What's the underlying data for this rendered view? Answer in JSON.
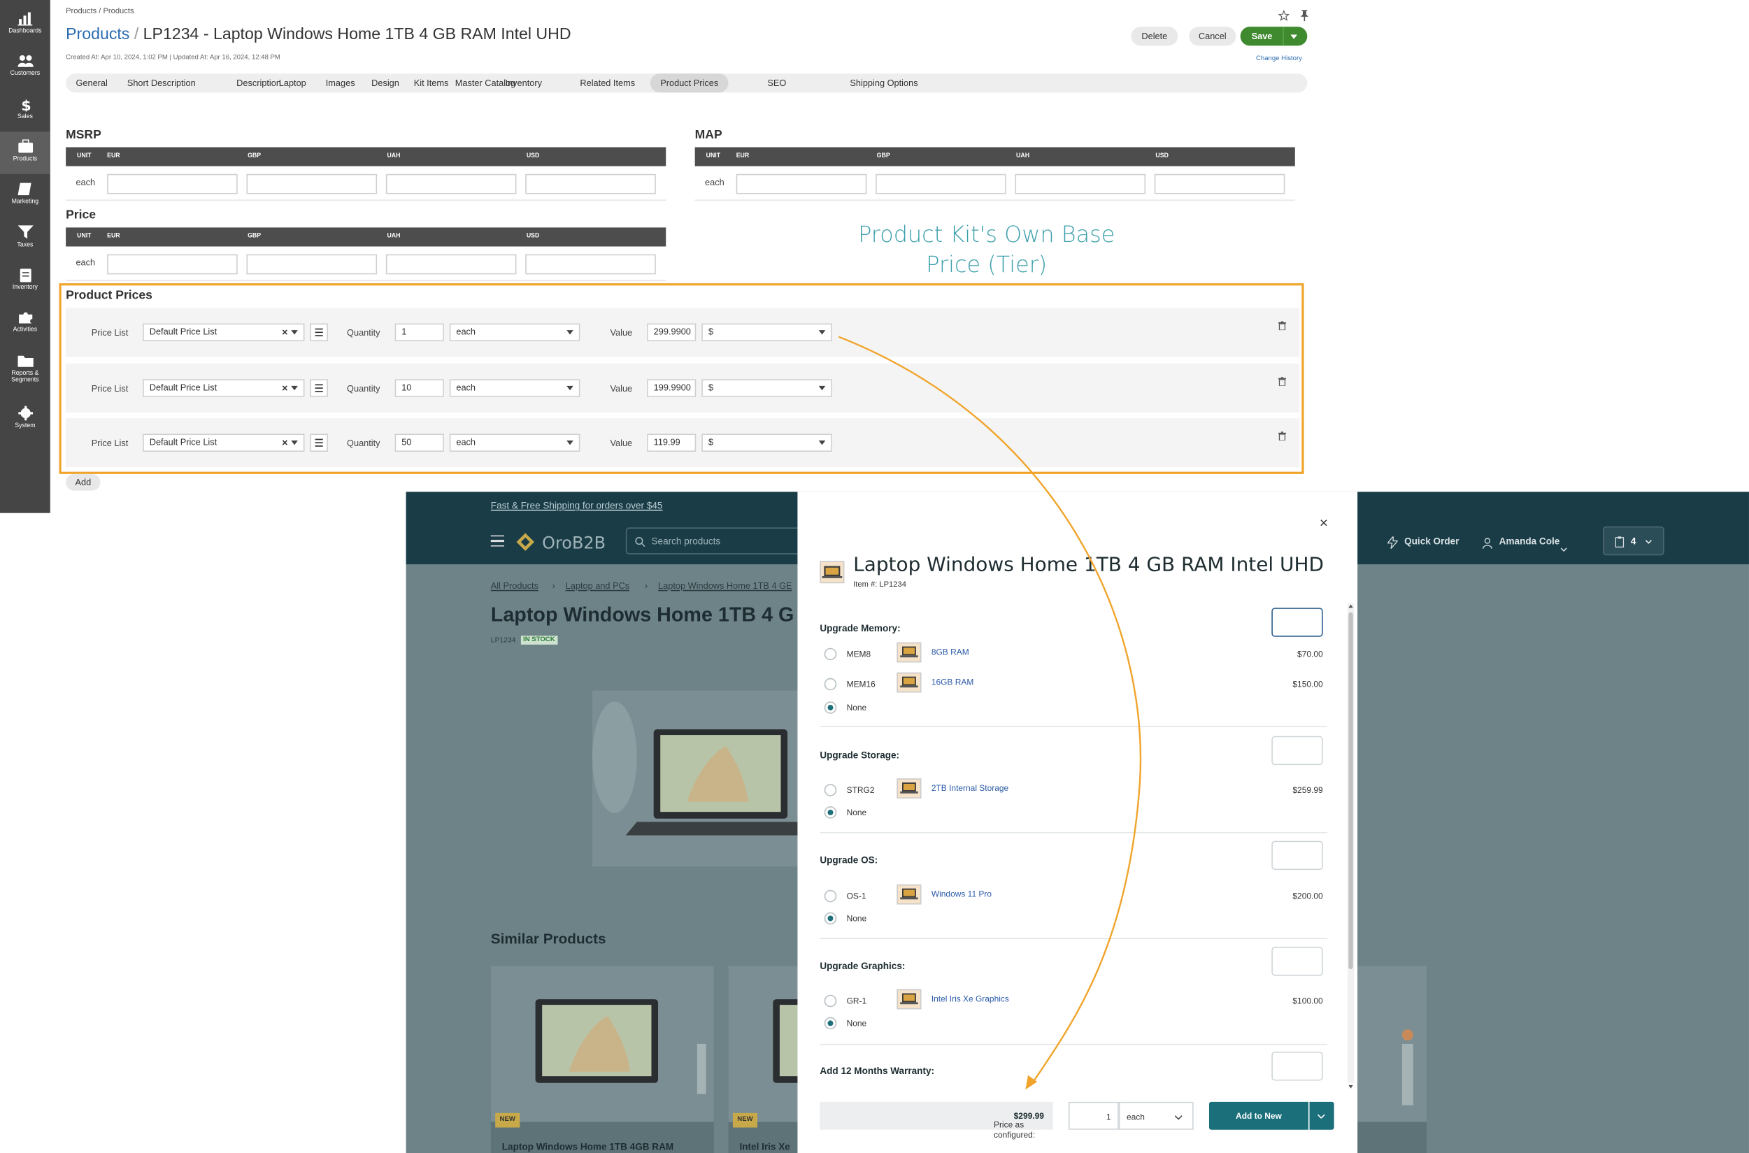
{
  "sidebar": {
    "items": [
      {
        "label": "Dashboards",
        "icon": "bar-chart-icon"
      },
      {
        "label": "Customers",
        "icon": "users-icon"
      },
      {
        "label": "Sales",
        "icon": "dollar-icon"
      },
      {
        "label": "Products",
        "icon": "briefcase-icon",
        "active": true
      },
      {
        "label": "Marketing",
        "icon": "book-icon"
      },
      {
        "label": "Taxes",
        "icon": "filter-icon"
      },
      {
        "label": "Inventory",
        "icon": "clipboard-icon"
      },
      {
        "label": "Activities",
        "icon": "puzzle-icon"
      },
      {
        "label": "Reports &",
        "label2": "Segments",
        "icon": "folder-icon"
      },
      {
        "label": "System",
        "icon": "gear-icon"
      }
    ]
  },
  "header": {
    "breadcrumb": "Products / Products",
    "title_link": "Products",
    "title_sep": "/",
    "title": "LP1234 - Laptop Windows Home 1TB 4 GB RAM Intel UHD",
    "meta": "Created At: Apr 10, 2024, 1:02 PM  |  Updated At: Apr 16, 2024, 12:48 PM",
    "delete_label": "Delete",
    "cancel_label": "Cancel",
    "save_label": "Save",
    "change_history": "Change History"
  },
  "tabs": [
    "General",
    "Short Description",
    "Description",
    "Laptop",
    "Images",
    "Design",
    "Kit Items",
    "Master Catalog",
    "Inventory",
    "Related Items",
    "Product Prices",
    "SEO",
    "Shipping Options"
  ],
  "active_tab": "Product Prices",
  "msrp": {
    "title": "MSRP",
    "columns": [
      "UNIT",
      "EUR",
      "GBP",
      "UAH",
      "USD"
    ],
    "unit": "each"
  },
  "map": {
    "title": "MAP",
    "columns": [
      "UNIT",
      "EUR",
      "GBP",
      "UAH",
      "USD"
    ],
    "unit": "each"
  },
  "price": {
    "title": "Price",
    "columns": [
      "UNIT",
      "EUR",
      "GBP",
      "UAH",
      "USD"
    ],
    "unit": "each"
  },
  "annotation": {
    "line1": "Product Kit's Own Base",
    "line2": "Price (Tier)"
  },
  "product_prices": {
    "title": "Product Prices",
    "labels": {
      "price_list": "Price List",
      "quantity": "Quantity",
      "value": "Value"
    },
    "rows": [
      {
        "price_list": "Default Price List",
        "quantity": "1",
        "unit": "each",
        "value": "299.9900",
        "currency": "$"
      },
      {
        "price_list": "Default Price List",
        "quantity": "10",
        "unit": "each",
        "value": "199.9900",
        "currency": "$"
      },
      {
        "price_list": "Default Price List",
        "quantity": "50",
        "unit": "each",
        "value": "119.99",
        "currency": "$"
      }
    ],
    "add_label": "Add"
  },
  "storefront": {
    "promo": "Fast & Free Shipping for orders over $45",
    "logo": "OroB2B",
    "search_placeholder": "Search products",
    "quick_order": "Quick Order",
    "user": "Amanda Cole",
    "cart_count": "4",
    "breadcrumbs": [
      "All Products",
      "Laptop and PCs",
      "Laptop Windows Home 1TB 4 GE"
    ],
    "title": "Laptop Windows Home 1TB 4 G",
    "sku": "LP1234",
    "stock": "IN STOCK",
    "similar_title": "Similar Products",
    "cards": [
      {
        "name": "Laptop Windows Home 1TB 4GB RAM",
        "badge": "NEW"
      },
      {
        "name": "Intel Iris Xe",
        "badge": "NEW"
      }
    ]
  },
  "modal": {
    "title": "Laptop Windows Home 1TB 4 GB RAM Intel UHD",
    "item": "Item #: LP1234",
    "groups": [
      {
        "title": "Upgrade Memory:",
        "options": [
          {
            "code": "MEM8",
            "name": "8GB RAM",
            "price": "$70.00"
          },
          {
            "code": "MEM16",
            "name": "16GB RAM",
            "price": "$150.00"
          },
          {
            "code": "None",
            "selected": true
          }
        ]
      },
      {
        "title": "Upgrade Storage:",
        "options": [
          {
            "code": "STRG2",
            "name": "2TB Internal Storage",
            "price": "$259.99"
          },
          {
            "code": "None",
            "selected": true
          }
        ]
      },
      {
        "title": "Upgrade OS:",
        "options": [
          {
            "code": "OS-1",
            "name": "Windows 11 Pro",
            "price": "$200.00"
          },
          {
            "code": "None",
            "selected": true
          }
        ]
      },
      {
        "title": "Upgrade Graphics:",
        "options": [
          {
            "code": "GR-1",
            "name": "Intel Iris Xe Graphics",
            "price": "$100.00"
          },
          {
            "code": "None",
            "selected": true
          }
        ]
      },
      {
        "title": "Add 12 Months Warranty:",
        "options": []
      }
    ],
    "price_label": "Price as configured:",
    "price_value": "$299.99",
    "qty": "1",
    "unit": "each",
    "add_button": "Add to New"
  },
  "colors": {
    "accent_orange": "#f0a42b",
    "annotation": "#3ea0ad",
    "save_green": "#3f8a2f",
    "store_teal": "#1a6f7a"
  }
}
